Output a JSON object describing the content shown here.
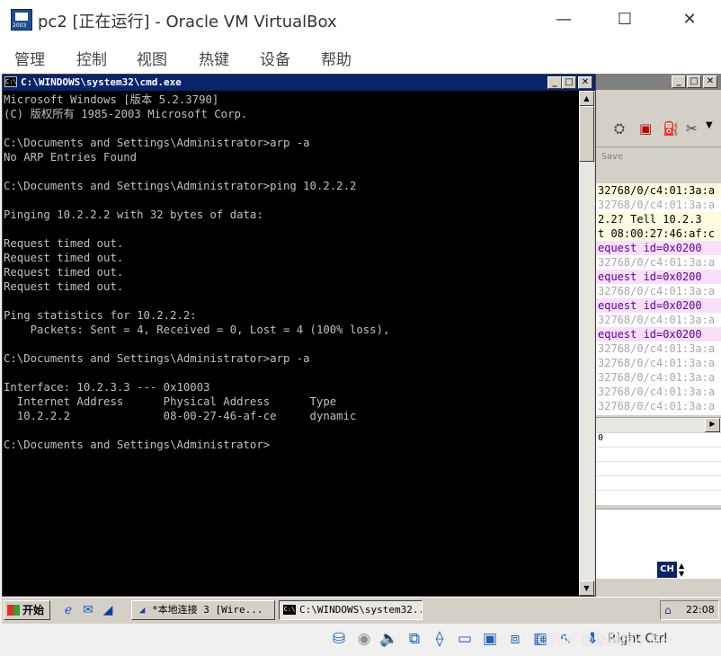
{
  "host_window": {
    "title": "pc2 [正在运行] - Oracle VM VirtualBox",
    "logo_year": "2003",
    "min_glyph": "—",
    "max_glyph": "☐",
    "close_glyph": "✕",
    "menu": [
      "管理",
      "控制",
      "视图",
      "热键",
      "设备",
      "帮助"
    ]
  },
  "cmd_window": {
    "title": "C:\\WINDOWS\\system32\\cmd.exe",
    "icon_label": "C:\\",
    "buttons": {
      "minimize": "_",
      "maximize": "□",
      "close": "✕"
    },
    "scroll_up": "▲",
    "scroll_down": "▼",
    "output": [
      "Microsoft Windows [版本 5.2.3790]",
      "(C) 版权所有 1985-2003 Microsoft Corp.",
      "",
      "C:\\Documents and Settings\\Administrator>arp -a",
      "No ARP Entries Found",
      "",
      "C:\\Documents and Settings\\Administrator>ping 10.2.2.2",
      "",
      "Pinging 10.2.2.2 with 32 bytes of data:",
      "",
      "Request timed out.",
      "Request timed out.",
      "Request timed out.",
      "Request timed out.",
      "",
      "Ping statistics for 10.2.2.2:",
      "    Packets: Sent = 4, Received = 0, Lost = 4 (100% loss),",
      "",
      "C:\\Documents and Settings\\Administrator>arp -a",
      "",
      "Interface: 10.2.3.3 --- 0x10003",
      "  Internet Address      Physical Address      Type",
      "  10.2.2.2              08-00-27-46-af-ce     dynamic",
      "",
      "C:\\Documents and Settings\\Administrator>"
    ]
  },
  "wireshark_window": {
    "buttons": {
      "minimize": "_",
      "maximize": "□",
      "close": "✕"
    },
    "filter_save_label": "Save",
    "toolbar_arrow": "▼",
    "packet_rows": [
      {
        "text": "32768/0/c4:01:3a:a",
        "style": "black"
      },
      {
        "text": "32768/0/c4:01:3a:a",
        "style": "grey"
      },
      {
        "text": "2.2?  Tell 10.2.3",
        "style": "black"
      },
      {
        "text": "t 08:00:27:46:af:c",
        "style": "black"
      },
      {
        "text": "equest  id=0x0200",
        "style": "pink"
      },
      {
        "text": "32768/0/c4:01:3a:a",
        "style": "grey"
      },
      {
        "text": "equest  id=0x0200",
        "style": "pink"
      },
      {
        "text": "32768/0/c4:01:3a:a",
        "style": "grey"
      },
      {
        "text": "equest  id=0x0200",
        "style": "pink"
      },
      {
        "text": "32768/0/c4:01:3a:a",
        "style": "grey"
      },
      {
        "text": "equest  id=0x0200",
        "style": "pink"
      },
      {
        "text": "32768/0/c4:01:3a:a",
        "style": "grey"
      },
      {
        "text": "32768/0/c4:01:3a:a",
        "style": "grey"
      },
      {
        "text": "32768/0/c4:01:3a:a",
        "style": "grey"
      },
      {
        "text": "32768/0/c4:01:3a:a",
        "style": "grey"
      },
      {
        "text": "32768/0/c4:01:3a:a",
        "style": "grey"
      }
    ],
    "detail_first_line": "0",
    "ime_label": "CH",
    "hscroll_arrow": "▶"
  },
  "taskbar": {
    "start_label": "开始",
    "tasks": [
      {
        "label": "*本地连接 3   [Wire...",
        "active": false
      },
      {
        "label": "C:\\WINDOWS\\system32...",
        "active": true
      }
    ],
    "clock": "22:08"
  },
  "status_bar": {
    "host_key": "Right Ctrl",
    "watermark": "CSDN @像风报不住~"
  },
  "colors": {
    "cmd_title": "#0a246a",
    "console_bg": "#000000",
    "console_fg": "#c0c0c0",
    "desktop": "#3a6ea5"
  }
}
